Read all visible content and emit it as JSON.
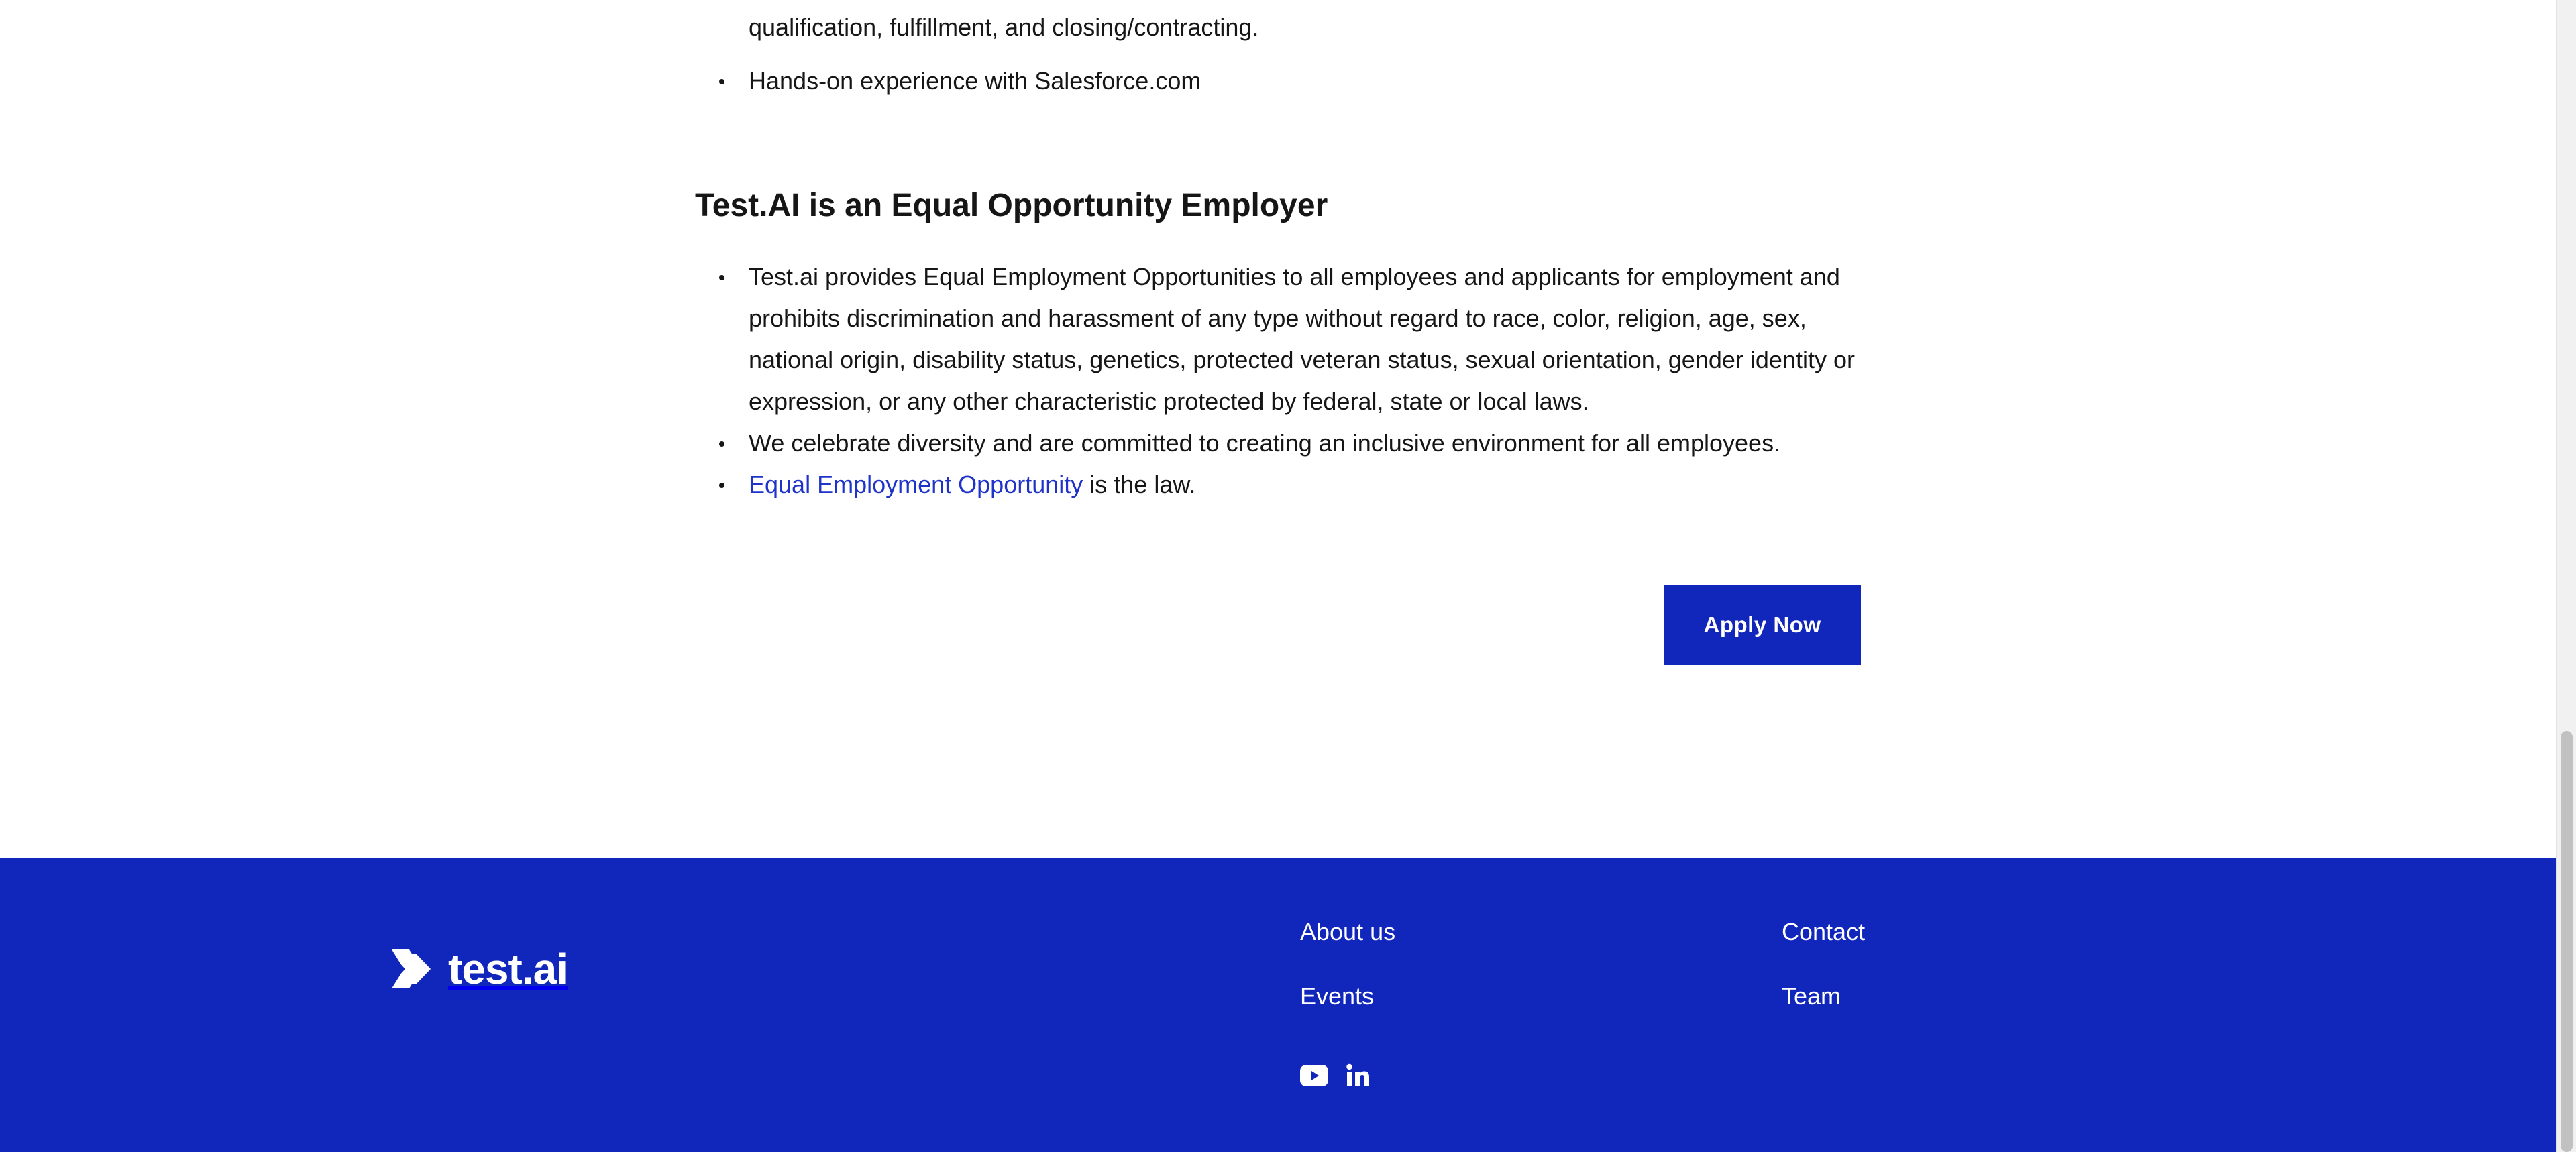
{
  "job_requirements": {
    "items": [
      "qualification, fulfillment, and closing/contracting.",
      "Hands-on experience with Salesforce.com"
    ]
  },
  "eeo": {
    "title": "Test.AI is an Equal Opportunity Employer",
    "items": [
      "Test.ai provides Equal Employment Opportunities to all employees and applicants for employment and prohibits discrimination and harassment of any type without regard to race, color, religion, age, sex, national origin, disability status, genetics, protected veteran status, sexual orientation, gender identity or expression, or any other characteristic protected by federal, state or local laws.",
      "We celebrate diversity and are committed to creating an inclusive environment for all employees."
    ],
    "link_text": "Equal Employment Opportunity",
    "link_suffix": " is the law."
  },
  "apply_button": {
    "label": "Apply Now"
  },
  "footer": {
    "logo_text": "test.ai",
    "links": {
      "about": "About us",
      "events": "Events",
      "contact": "Contact",
      "team": "Team"
    },
    "social": [
      "youtube-icon",
      "linkedin-icon"
    ]
  },
  "colors": {
    "brand_blue": "#1126bb",
    "link_blue": "#1f33c9",
    "text": "#161616"
  }
}
